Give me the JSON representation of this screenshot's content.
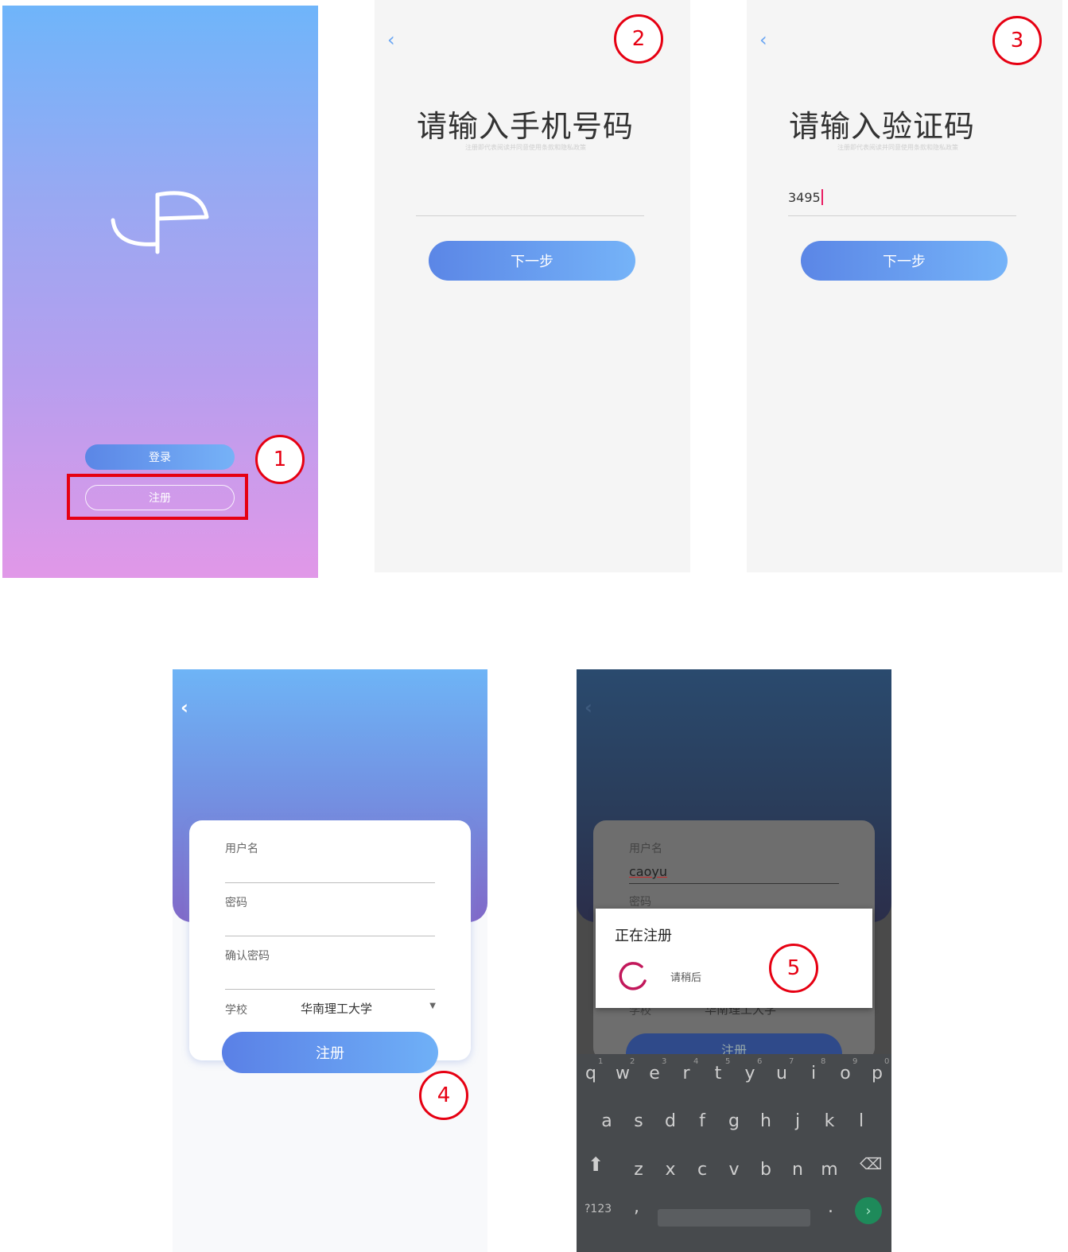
{
  "markers": [
    "1",
    "2",
    "3",
    "4",
    "5"
  ],
  "screen1": {
    "login_label": "登录",
    "register_label": "注册"
  },
  "screen2": {
    "title": "请输入手机号码",
    "hint": "注册即代表阅读并同意使用条款和隐私政策",
    "phone_value": "",
    "next_label": "下一步"
  },
  "screen3": {
    "title": "请输入验证码",
    "hint": "注册即代表阅读并同意使用条款和隐私政策",
    "code_value": "3495",
    "next_label": "下一步"
  },
  "screen4": {
    "username_label": "用户名",
    "password_label": "密码",
    "confirm_label": "确认密码",
    "school_label": "学校",
    "school_value": "华南理工大学",
    "register_label": "注册"
  },
  "screen5": {
    "username_label": "用户名",
    "username_value": "caoyu",
    "password_label": "密码",
    "school_label": "学校",
    "school_value": "华南理工大学",
    "register_label": "注册",
    "dialog_title": "正在注册",
    "dialog_message": "请稍后",
    "keyboard": {
      "row1": [
        "q",
        "w",
        "e",
        "r",
        "t",
        "y",
        "u",
        "i",
        "o",
        "p"
      ],
      "row1_nums": [
        "1",
        "2",
        "3",
        "4",
        "5",
        "6",
        "7",
        "8",
        "9",
        "0"
      ],
      "row2": [
        "a",
        "s",
        "d",
        "f",
        "g",
        "h",
        "j",
        "k",
        "l"
      ],
      "row3": [
        "z",
        "x",
        "c",
        "v",
        "b",
        "n",
        "m"
      ],
      "symbols_label": "?123",
      "comma": ",",
      "period": "."
    }
  },
  "colors": {
    "annotation_red": "#e60012",
    "button_gradient_start": "#5b86e6",
    "button_gradient_end": "#75b3f8",
    "spinner": "#c2185b"
  }
}
